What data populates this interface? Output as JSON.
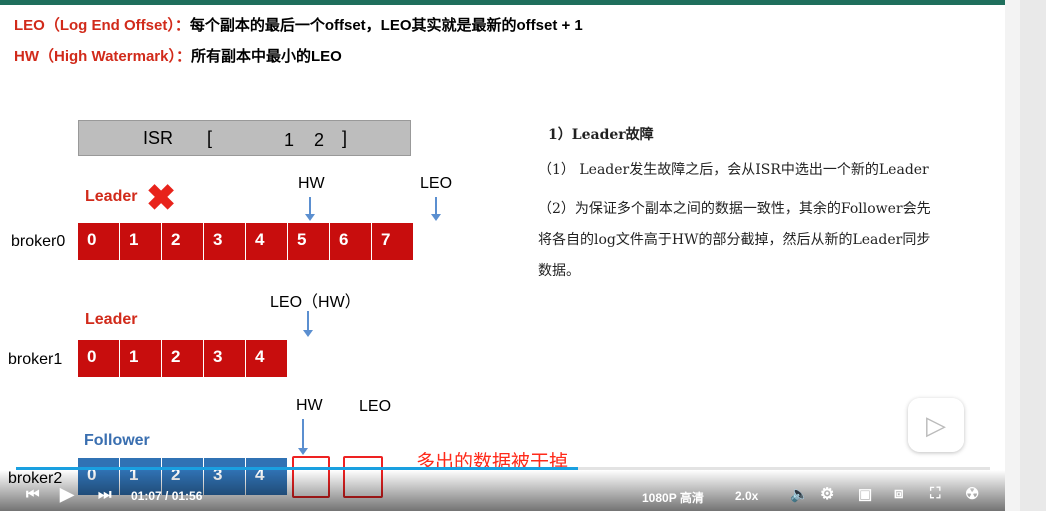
{
  "definitions": [
    {
      "term": "LEO（Log End Offset）：",
      "desc": "每个副本的最后一个offset，LEO其实就是最新的offset + 1"
    },
    {
      "term": "HW（High Watermark）：",
      "desc": "所有副本中最小的LEO"
    }
  ],
  "isr": {
    "label": "ISR",
    "bracket_open": "[",
    "members": "1    2",
    "bracket_close": "]"
  },
  "brokers": [
    {
      "name": "broker0",
      "role": "Leader",
      "offsets": [
        "0",
        "1",
        "2",
        "3",
        "4",
        "5",
        "6",
        "7"
      ],
      "markers": [
        "HW",
        "LEO"
      ]
    },
    {
      "name": "broker1",
      "role": "Leader",
      "offsets": [
        "0",
        "1",
        "2",
        "3",
        "4"
      ],
      "markers": [
        "LEO（HW）"
      ]
    },
    {
      "name": "broker2",
      "role": "Follower",
      "offsets": [
        "0",
        "1",
        "2",
        "3",
        "4"
      ],
      "markers": [
        "HW",
        "LEO"
      ]
    }
  ],
  "annotation": "多出的数据被干掉",
  "notes": {
    "title": "1）Leader故障",
    "p1": "（1） Leader发生故障之后，会从ISR中选出一个新的Leader",
    "p2a": "（2）为保证多个副本之间的数据一致性，其余的Follower会先",
    "p2b": "将各自的log文件高于HW的部分截掉，然后从新的Leader同步",
    "p2c": "数据。"
  },
  "player": {
    "time": "01:07 / 01:56",
    "quality": "1080P 高清",
    "speed": "2.0x",
    "progress": 0.577,
    "colors": {
      "progress": "#1aa0e0"
    }
  }
}
